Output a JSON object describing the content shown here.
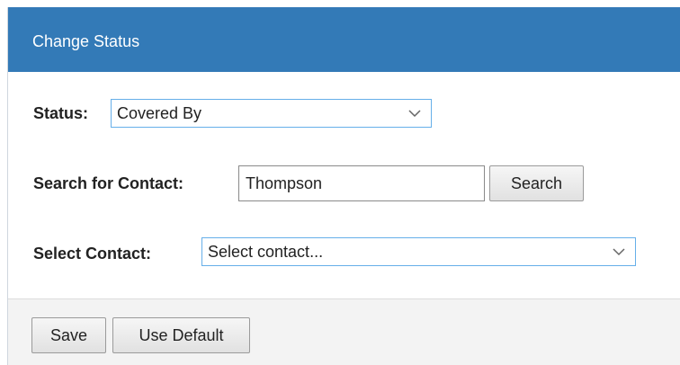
{
  "dialog": {
    "title": "Change Status"
  },
  "form": {
    "status_label": "Status:",
    "status_value": "Covered By",
    "search_label": "Search for Contact:",
    "search_value": "Thompson",
    "search_button": "Search",
    "select_contact_label": "Select Contact:",
    "select_contact_value": "Select contact..."
  },
  "footer": {
    "save_label": "Save",
    "use_default_label": "Use Default"
  },
  "colors": {
    "header_bg": "#337ab7",
    "focus_border": "#66afe9"
  },
  "icons": {
    "dropdown": "chevron-down-icon"
  }
}
